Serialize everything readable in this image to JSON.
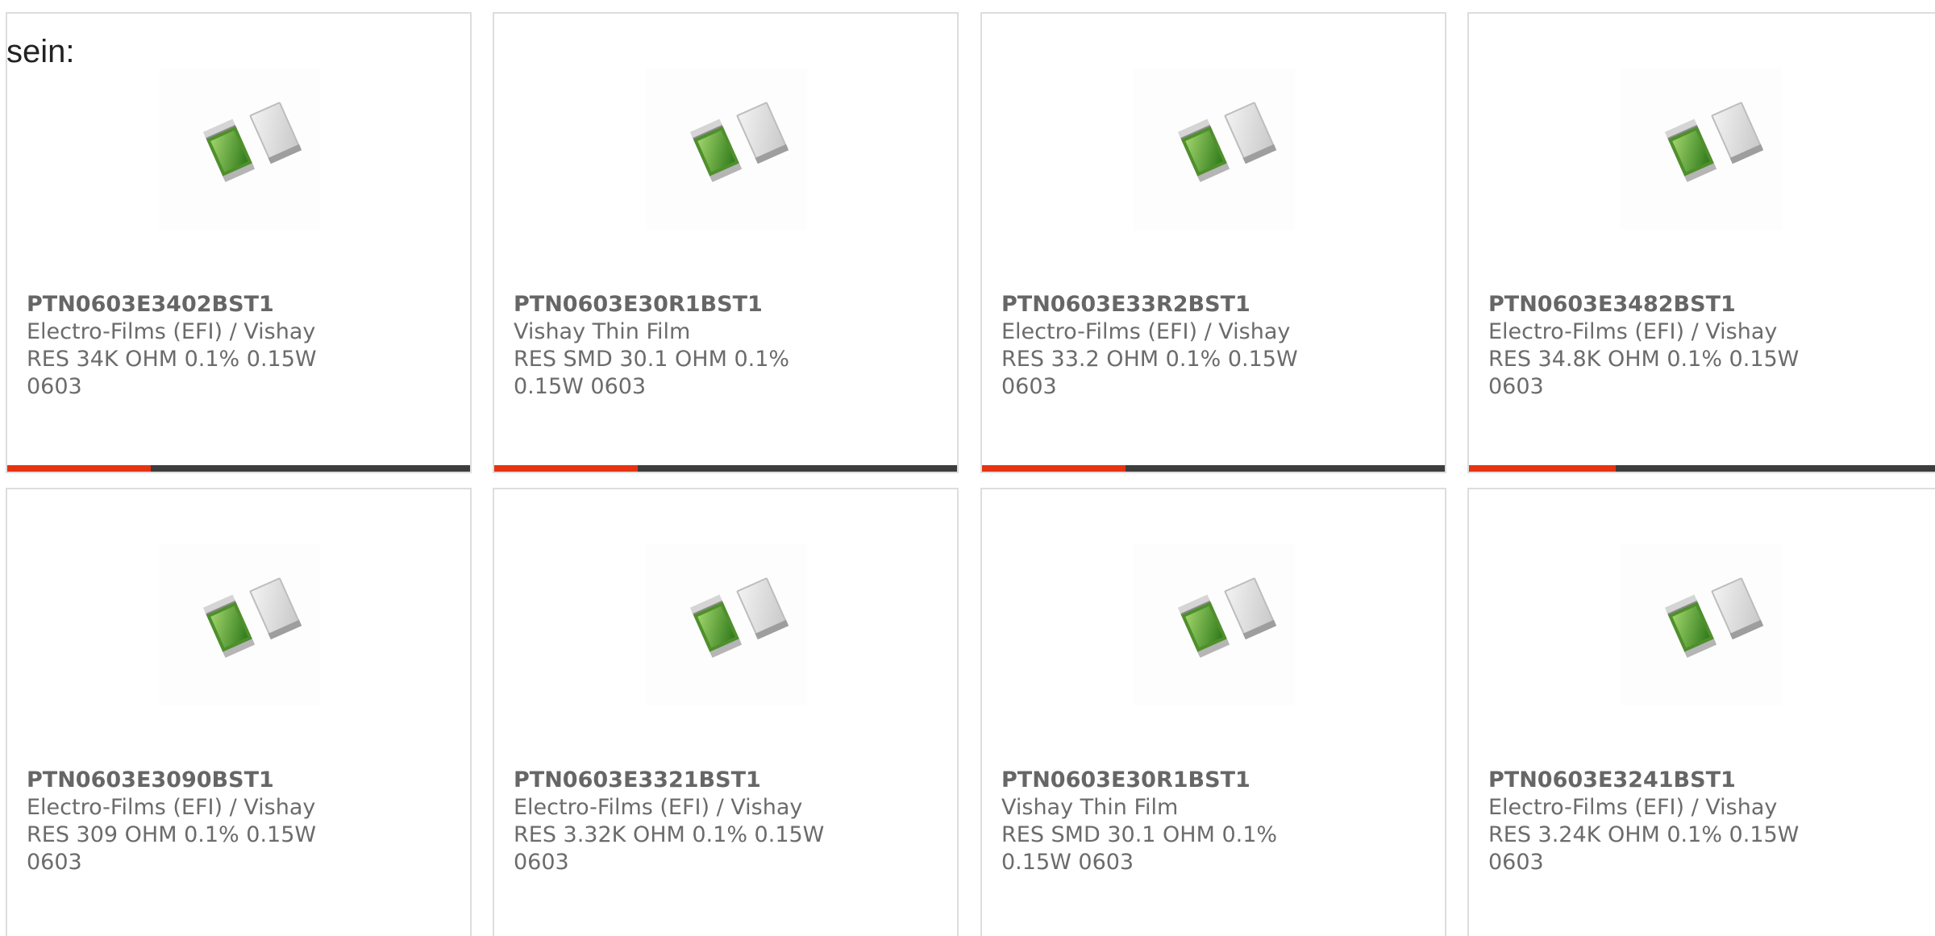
{
  "intro_text": "sein:",
  "colors": {
    "accent": "#e63312",
    "bar_track": "#3d3d3d",
    "text": "#6b6b6b",
    "border": "#dddddd"
  },
  "products": [
    {
      "part_number": "PTN0603E3402BST1",
      "manufacturer": "Electro-Films (EFI) / Vishay",
      "description": "RES 34K OHM 0.1% 0.15W 0603",
      "image_icon": "resistor-chip-icon",
      "bar_fill": 0.31
    },
    {
      "part_number": "PTN0603E30R1BST1",
      "manufacturer": "Vishay Thin Film",
      "description": "RES SMD 30.1 OHM 0.1% 0.15W 0603",
      "image_icon": "resistor-chip-icon",
      "bar_fill": 0.31
    },
    {
      "part_number": "PTN0603E33R2BST1",
      "manufacturer": "Electro-Films (EFI) / Vishay",
      "description": "RES 33.2 OHM 0.1% 0.15W 0603",
      "image_icon": "resistor-chip-icon",
      "bar_fill": 0.31
    },
    {
      "part_number": "PTN0603E3482BST1",
      "manufacturer": "Electro-Films (EFI) / Vishay",
      "description": "RES 34.8K OHM 0.1% 0.15W 0603",
      "image_icon": "resistor-chip-icon",
      "bar_fill": 0.31
    },
    {
      "part_number": "PTN0603E3090BST1",
      "manufacturer": "Electro-Films (EFI) / Vishay",
      "description": "RES 309 OHM 0.1% 0.15W 0603",
      "image_icon": "resistor-chip-icon"
    },
    {
      "part_number": "PTN0603E3321BST1",
      "manufacturer": "Electro-Films (EFI) / Vishay",
      "description": "RES 3.32K OHM 0.1% 0.15W 0603",
      "image_icon": "resistor-chip-icon"
    },
    {
      "part_number": "PTN0603E30R1BST1",
      "manufacturer": "Vishay Thin Film",
      "description": "RES SMD 30.1 OHM 0.1% 0.15W 0603",
      "image_icon": "resistor-chip-icon"
    },
    {
      "part_number": "PTN0603E3241BST1",
      "manufacturer": "Electro-Films (EFI) / Vishay",
      "description": "RES 3.24K OHM 0.1% 0.15W 0603",
      "image_icon": "resistor-chip-icon"
    }
  ]
}
